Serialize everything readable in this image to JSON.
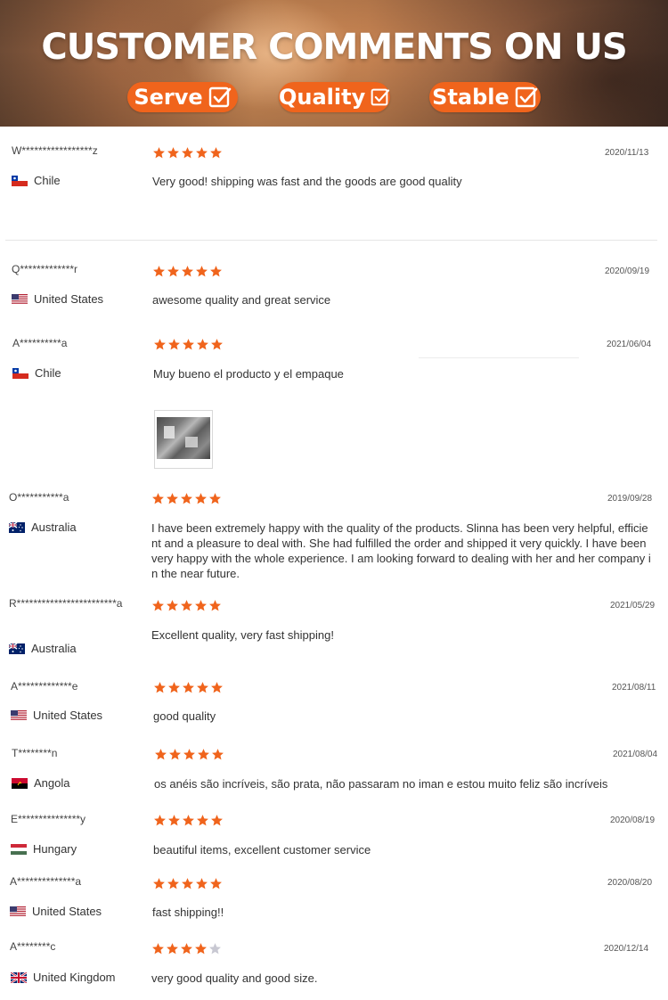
{
  "banner": {
    "title": "CUSTOMER COMMENTS ON US",
    "badges": [
      "Serve",
      "Quality",
      "Stable"
    ],
    "accent_color": "#f0641c"
  },
  "star_color": "#f0641c",
  "star_empty_color": "#c8c8d2",
  "reviews": [
    {
      "user": "W*****************z",
      "country": "Chile",
      "flag": "flag-chile",
      "rating": 5,
      "date": "2020/11/13",
      "comment": "Very good! shipping was fast and the goods are good quality"
    },
    {
      "user": "Q*************r",
      "country": "United States",
      "flag": "flag-united-states",
      "rating": 5,
      "date": "2020/09/19",
      "comment": "awesome quality and great service"
    },
    {
      "user": "A**********a",
      "country": "Chile",
      "flag": "flag-chile",
      "rating": 5,
      "date": "2021/06/04",
      "comment": "Muy bueno el producto y el empaque",
      "photo": "review-photo-thumbnail"
    },
    {
      "user": "O***********a",
      "country": "Australia",
      "flag": "flag-australia",
      "rating": 5,
      "date": "2019/09/28",
      "comment": "I have been extremely happy with the quality of the products. Slinna has been very helpful, efficient and a pleasure to deal with. She had fulfilled the order and shipped it very quickly. I have been very happy with the whole experience. I am looking forward to dealing with her and her company in the near future."
    },
    {
      "user": "R************************a",
      "country": "Australia",
      "flag": "flag-australia",
      "rating": 5,
      "date": "2021/05/29",
      "comment": "Excellent quality, very fast shipping!"
    },
    {
      "user": "A*************e",
      "country": "United States",
      "flag": "flag-united-states",
      "rating": 5,
      "date": "2021/08/11",
      "comment": "good quality"
    },
    {
      "user": "T********n",
      "country": "Angola",
      "flag": "flag-angola",
      "rating": 5,
      "date": "2021/08/04",
      "comment": "os anéis são incríveis, são prata, não passaram no iman e estou muito feliz são incríveis"
    },
    {
      "user": "E***************y",
      "country": "Hungary",
      "flag": "flag-hungary",
      "rating": 5,
      "date": "2020/08/19",
      "comment": "beautiful items, excellent customer service"
    },
    {
      "user": "A**************a",
      "country": "United States",
      "flag": "flag-united-states",
      "rating": 5,
      "date": "2020/08/20",
      "comment": "fast shipping!!"
    },
    {
      "user": "A********c",
      "country": "United Kingdom",
      "flag": "flag-united-kingdom",
      "rating": 4,
      "date": "2020/12/14",
      "comment": "very good quality and good size."
    }
  ]
}
